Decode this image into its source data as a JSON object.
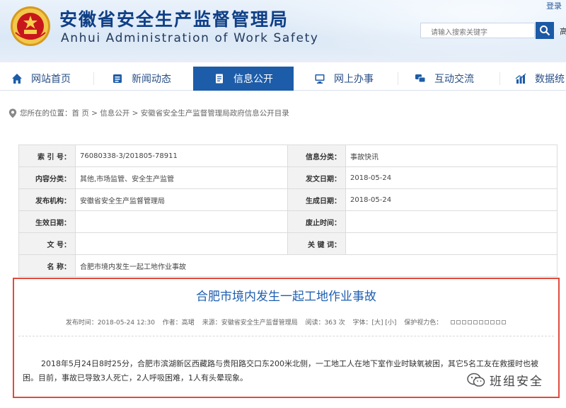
{
  "header": {
    "title_cn": "安徽省安全生产监督管理局",
    "title_en": "Anhui Administration of Work Safety",
    "login": "登录",
    "search_placeholder": "请输入搜索关键字",
    "search_extra": "高"
  },
  "nav": {
    "items": [
      {
        "label": "网站首页",
        "icon": "home-icon"
      },
      {
        "label": "新闻动态",
        "icon": "news-icon"
      },
      {
        "label": "信息公开",
        "icon": "document-icon",
        "active": true
      },
      {
        "label": "网上办事",
        "icon": "monitor-icon"
      },
      {
        "label": "互动交流",
        "icon": "chat-icon"
      },
      {
        "label": "数据统",
        "icon": "chart-icon"
      }
    ]
  },
  "breadcrumb": {
    "text": "您所在的位置：首 页 > 信息公开 > 安徽省安全生产监督管理局政府信息公开目录"
  },
  "info": {
    "index_label": "索 引 号：",
    "index_value": "76080338-3/201805-78911",
    "category_label": "信息分类：",
    "category_value": "事故快讯",
    "content_label": "内容分类：",
    "content_value": "其他,市场监管、安全生产监管",
    "publish_date_label": "发文日期：",
    "publish_date_value": "2018-05-24",
    "publisher_label": "发布机构：",
    "publisher_value": "安徽省安全生产监督管理局",
    "gen_date_label": "生成日期：",
    "gen_date_value": "2018-05-24",
    "effective_label": "生效日期：",
    "effective_value": "",
    "abolish_label": "废止时间：",
    "abolish_value": "",
    "docno_label": "文   号：",
    "docno_value": "",
    "keyword_label": "关 键 词：",
    "keyword_value": "",
    "name_label": "名   称：",
    "name_value": "合肥市境内发生一起工地作业事故"
  },
  "article": {
    "title": "合肥市境内发生一起工地作业事故",
    "meta": {
      "published": "发布时间：2018-05-24 12:30",
      "author": "作者：高珺",
      "source": "来源：安徽省安全生产监督管理局",
      "views": "阅读：363 次",
      "font": "字体：[大] [小]",
      "eye": "保护视力色："
    },
    "body_line1": "2018年5月24日8时25分，合肥市滨湖新区西藏路与贵阳路交口东200米北侧，一工地工人在地下室作业时缺氧被困，其它5名工友在救援时也被",
    "body_line2": "困。目前，事故已导致3人死亡，2人呼吸困难，1人有头晕现象。"
  },
  "watermark": {
    "text": "班组安全"
  },
  "colors": {
    "brand_blue": "#1d5ca8",
    "title_blue": "#0f3f86",
    "highlight_red": "#e24a3b"
  }
}
